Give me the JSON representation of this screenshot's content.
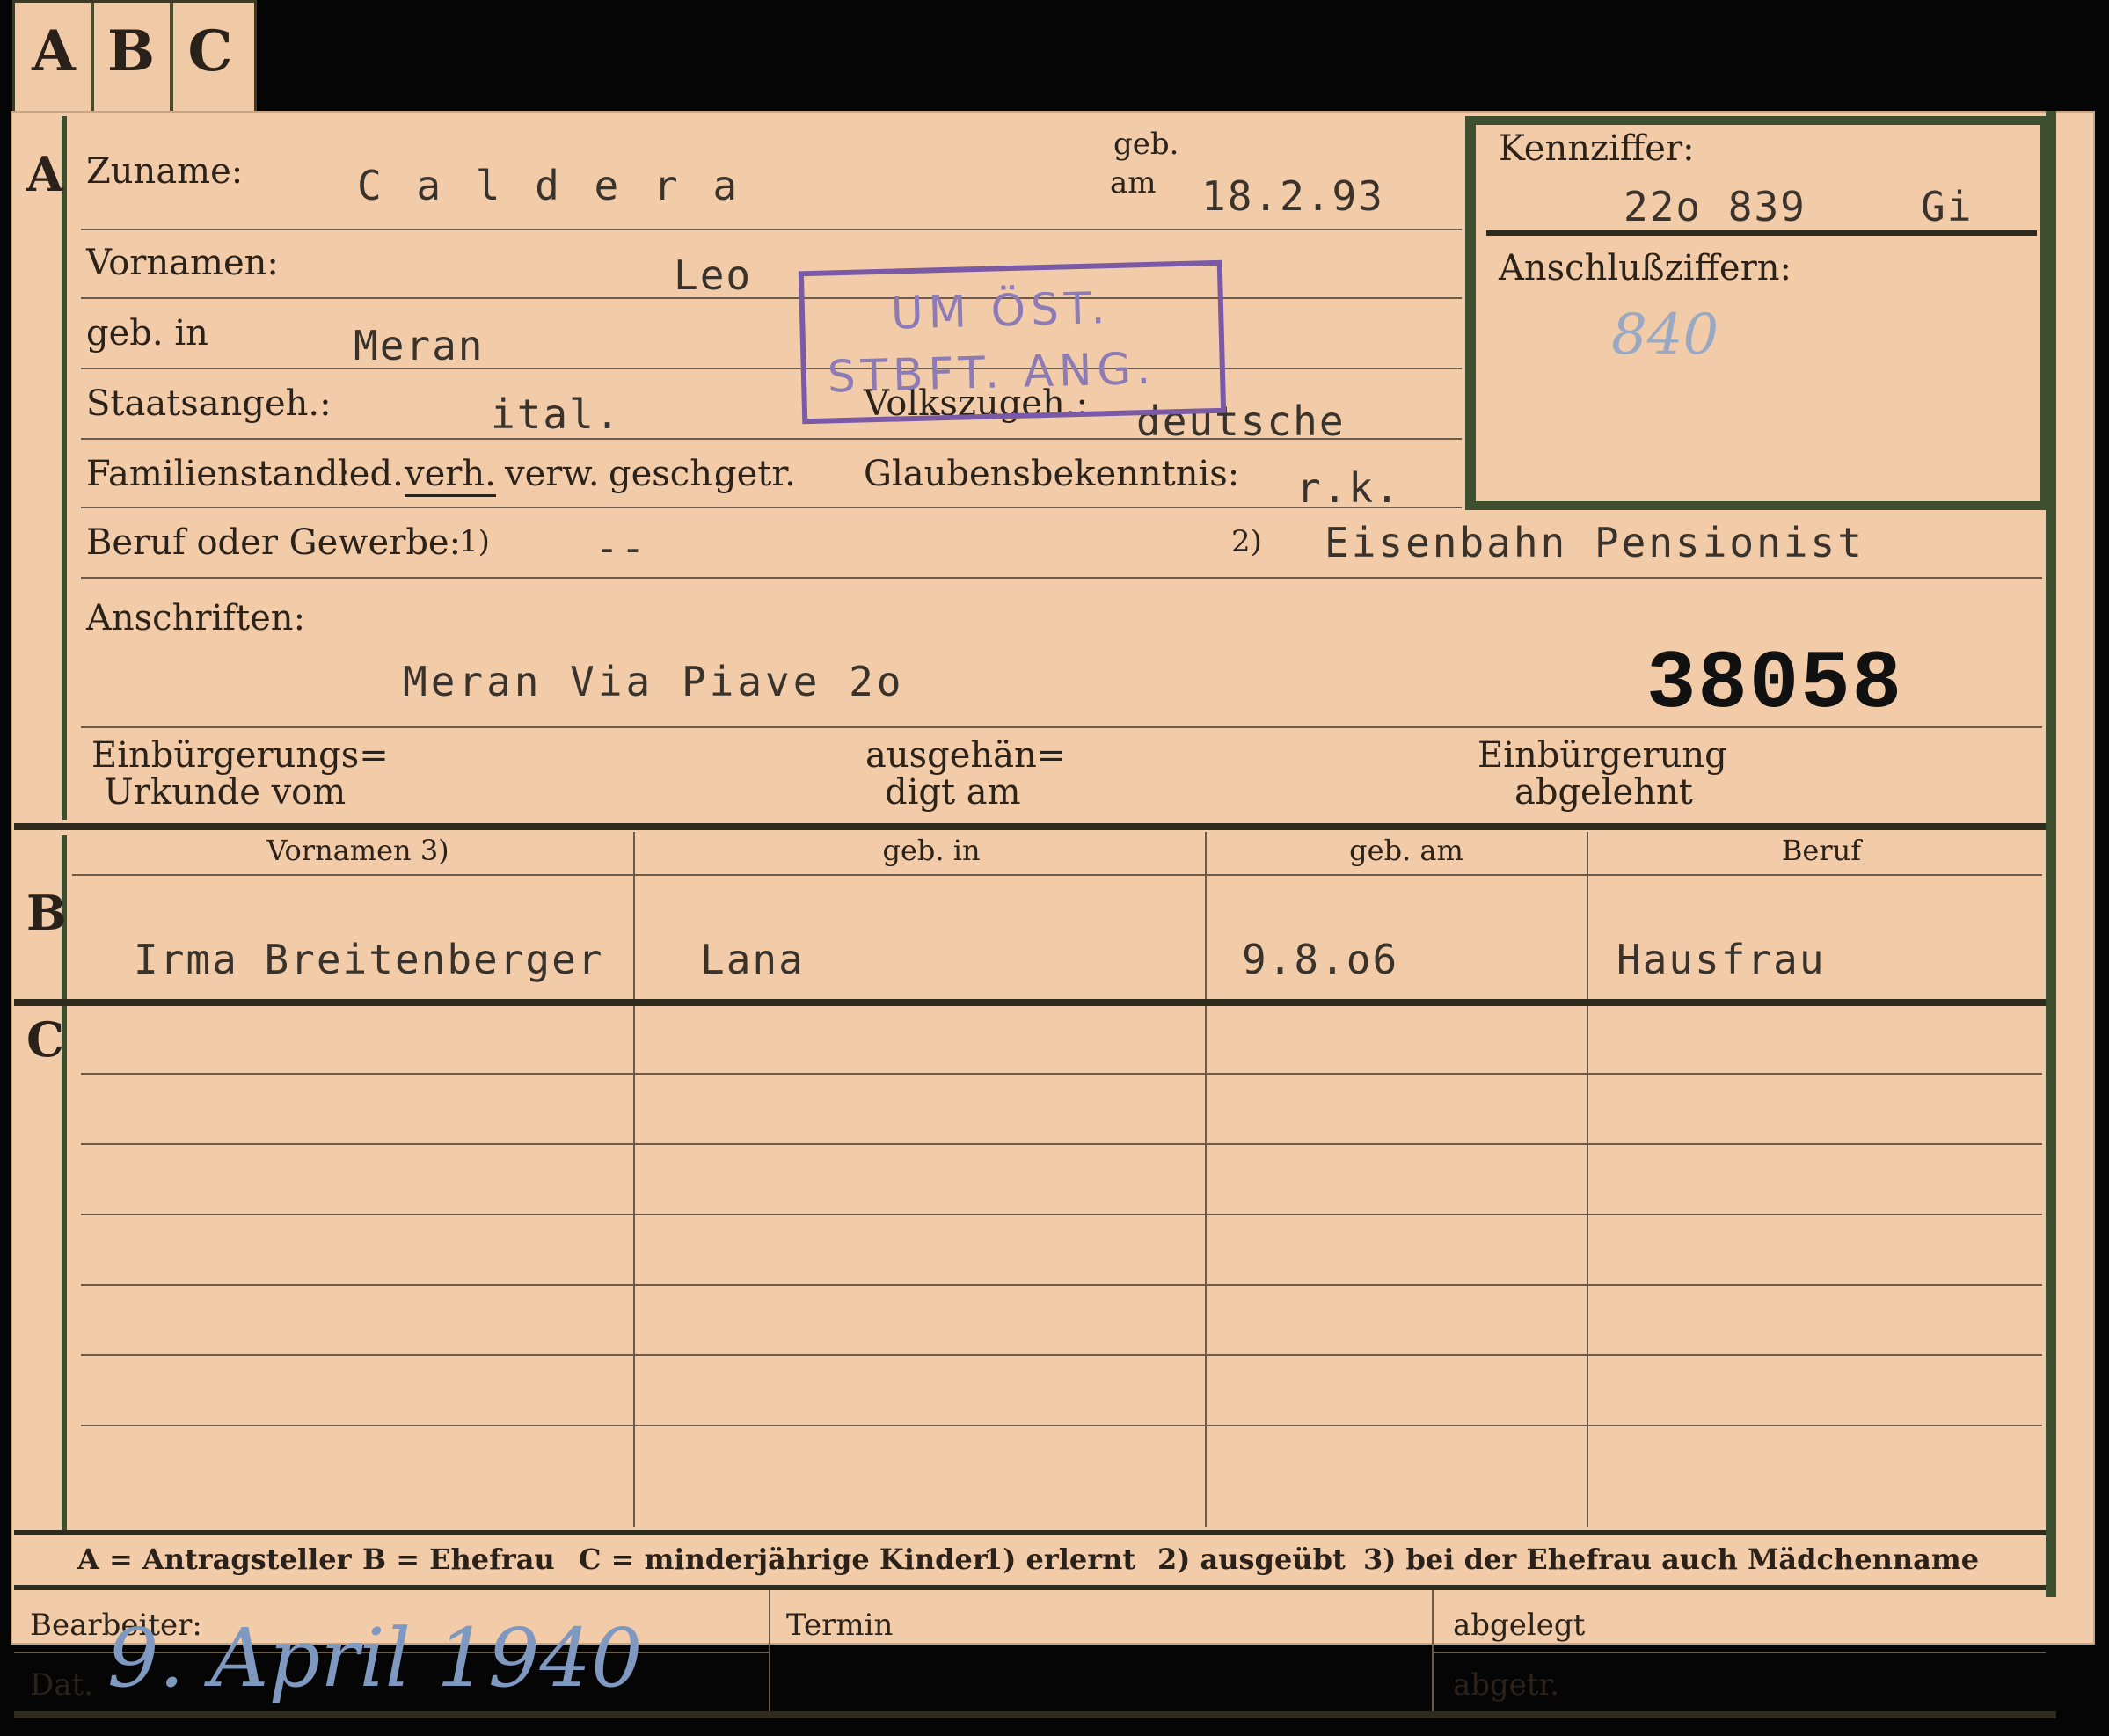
{
  "tab_letters": [
    "A",
    "B",
    "C"
  ],
  "section_letters": {
    "a": "A",
    "b": "B",
    "c": "C"
  },
  "section_a": {
    "zuname_label": "Zuname:",
    "zuname_value": "C a l d e r a",
    "geb_am_label_1": "geb.",
    "geb_am_label_2": "am",
    "geb_am_value": "18.2.93",
    "vornamen_label": "Vornamen:",
    "vornamen_value": "Leo",
    "geb_in_label": "geb. in",
    "geb_in_value": "Meran",
    "staatsangeh_label": "Staatsangeh.:",
    "staatsangeh_value": "ital.",
    "volkszugeh_label": "Volkszugeh.:",
    "volkszugeh_value": "deutsche",
    "familienstand_label": "Familienstand:",
    "familienstand_options": [
      "led.",
      "verh.",
      "verw.",
      "gesch.",
      "getr."
    ],
    "familienstand_selected": "verh.",
    "glaubens_label": "Glaubensbekenntnis:",
    "glaubens_value": "r.k.",
    "beruf_label": "Beruf oder Gewerbe:",
    "beruf_note1": "1)",
    "beruf_value1": "--",
    "beruf_note2": "2)",
    "beruf_value2": "Eisenbahn  Pensionist",
    "anschriften_label": "Anschriften:",
    "anschriften_value": "Meran  Via Piave 2o",
    "record_number": "38058",
    "einbuergerung_line1": "Einbürgerungs=",
    "einbuergerung_line2": "Urkunde vom",
    "ausgehaendigt_line1": "ausgehän=",
    "ausgehaendigt_line2": "digt am",
    "abgelehnt_line1": "Einbürgerung",
    "abgelehnt_line2": "abgelehnt"
  },
  "kennziffer": {
    "label": "Kennziffer:",
    "value": "22o 839",
    "suffix": "Gi",
    "anschluss_label": "Anschlußziffern:",
    "anschluss_value": "840"
  },
  "stamp": {
    "line1": "UM ÖST.",
    "line2": "STBFT. ANG."
  },
  "section_b": {
    "headers": [
      "Vornamen 3)",
      "geb. in",
      "geb. am",
      "Beruf"
    ],
    "row": [
      "Irma Breitenberger",
      "Lana",
      "9.8.o6",
      "Hausfrau"
    ]
  },
  "legend": {
    "a": "A = Antragsteller",
    "b": "B = Ehefrau",
    "c": "C = minderjährige Kinder",
    "n1": "1) erlernt",
    "n2": "2) ausgeübt",
    "n3": "3) bei der Ehefrau auch Mädchenname"
  },
  "footer": {
    "bearbeiter_label": "Bearbeiter:",
    "dat_label": "Dat.",
    "date_handwritten": "9. April 1940",
    "termin_label": "Termin",
    "abgelegt_label": "abgelegt",
    "abgetr_label": "abgetr."
  }
}
